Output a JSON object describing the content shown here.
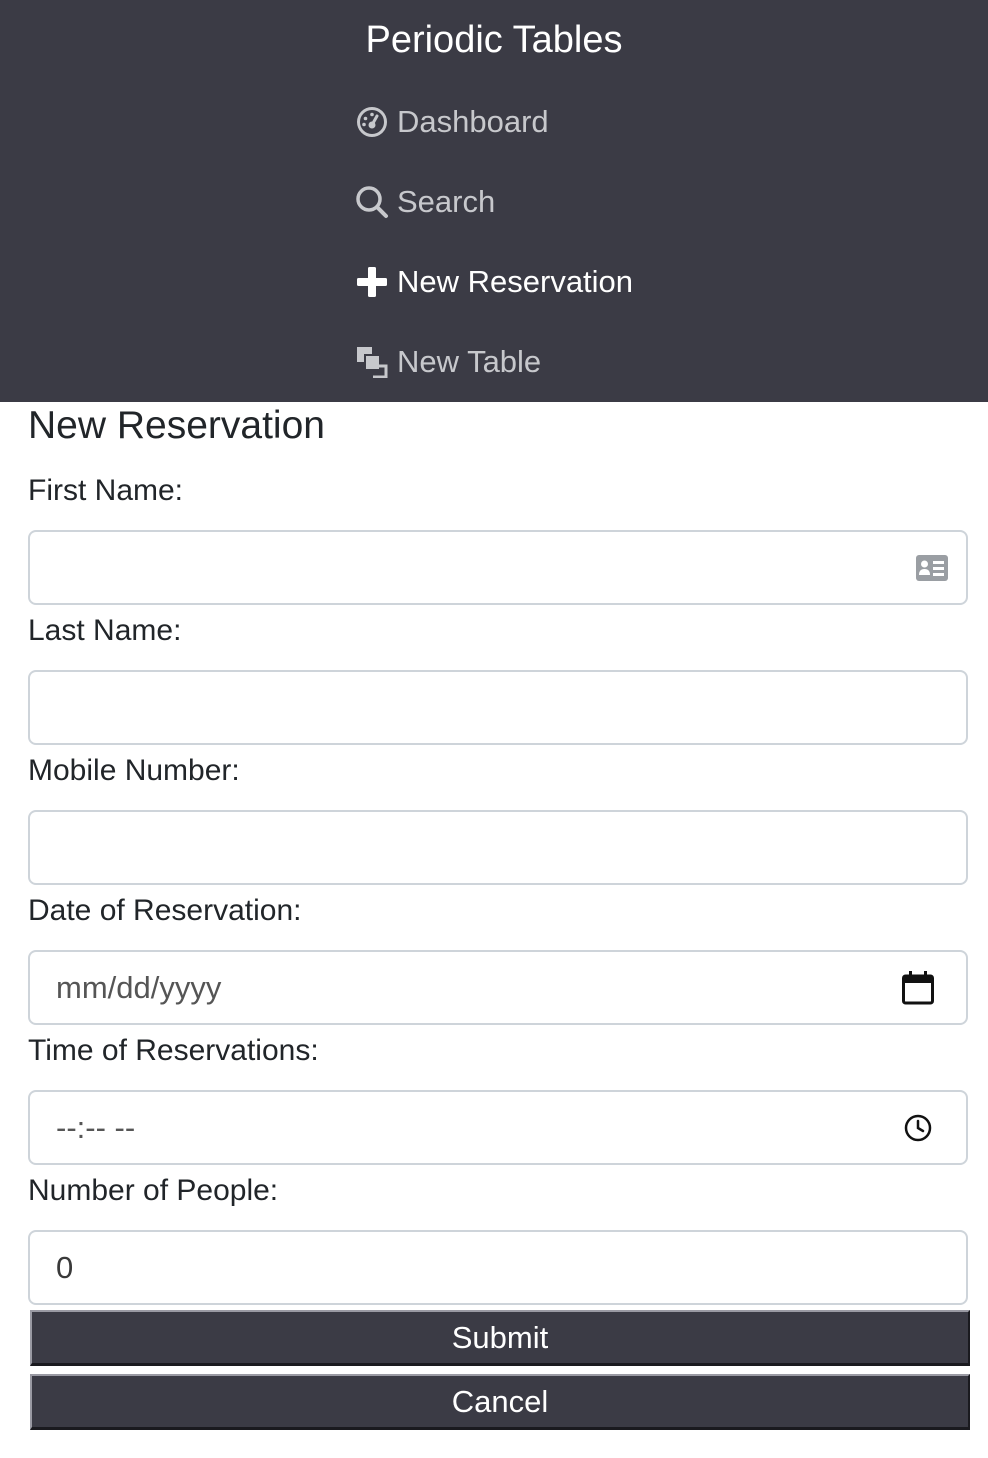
{
  "nav": {
    "brand": "Periodic Tables",
    "items": [
      {
        "label": "Dashboard",
        "icon": "dashboard-icon"
      },
      {
        "label": "Search",
        "icon": "search-icon"
      },
      {
        "label": "New Reservation",
        "icon": "plus-icon"
      },
      {
        "label": "New Table",
        "icon": "layers-icon"
      }
    ]
  },
  "form": {
    "title": "New Reservation",
    "first_name_label": "First Name:",
    "last_name_label": "Last Name:",
    "mobile_label": "Mobile Number:",
    "date_label": "Date of Reservation:",
    "date_placeholder": "mm/dd/yyyy",
    "time_label": "Time of Reservations:",
    "time_placeholder": "--:-- --",
    "people_label": "Number of People:",
    "people_value": "0",
    "submit_label": "Submit",
    "cancel_label": "Cancel"
  },
  "colors": {
    "nav_background": "#3b3b45",
    "button_background": "#3b3b45",
    "input_border": "#ced4da"
  }
}
